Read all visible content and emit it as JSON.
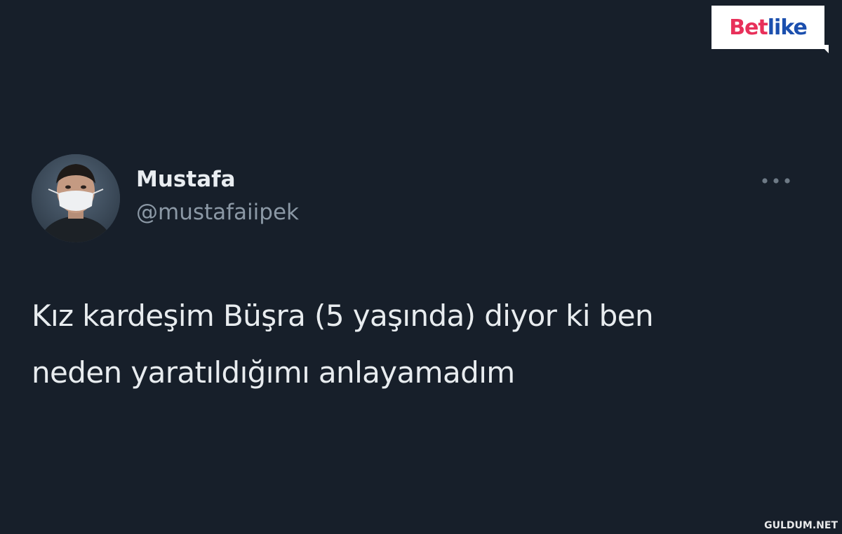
{
  "brand_logo": {
    "part1": "Bet",
    "part2": "like",
    "color_primary": "#e8305a",
    "color_secondary": "#1b4fae"
  },
  "tweet": {
    "author": {
      "name": "Mustafa",
      "handle": "@mustafaiipek"
    },
    "more_icon": "more-horizontal-icon",
    "text_lines": [
      "Kız kardeşim Büşra (5 yaşında) diyor ki ben",
      "neden yaratıldığımı anlayamadım"
    ]
  },
  "watermark": "GULDUM.NET",
  "colors": {
    "background": "#171f2a",
    "text_primary": "#e8ecef",
    "text_secondary": "#8b98a5"
  }
}
